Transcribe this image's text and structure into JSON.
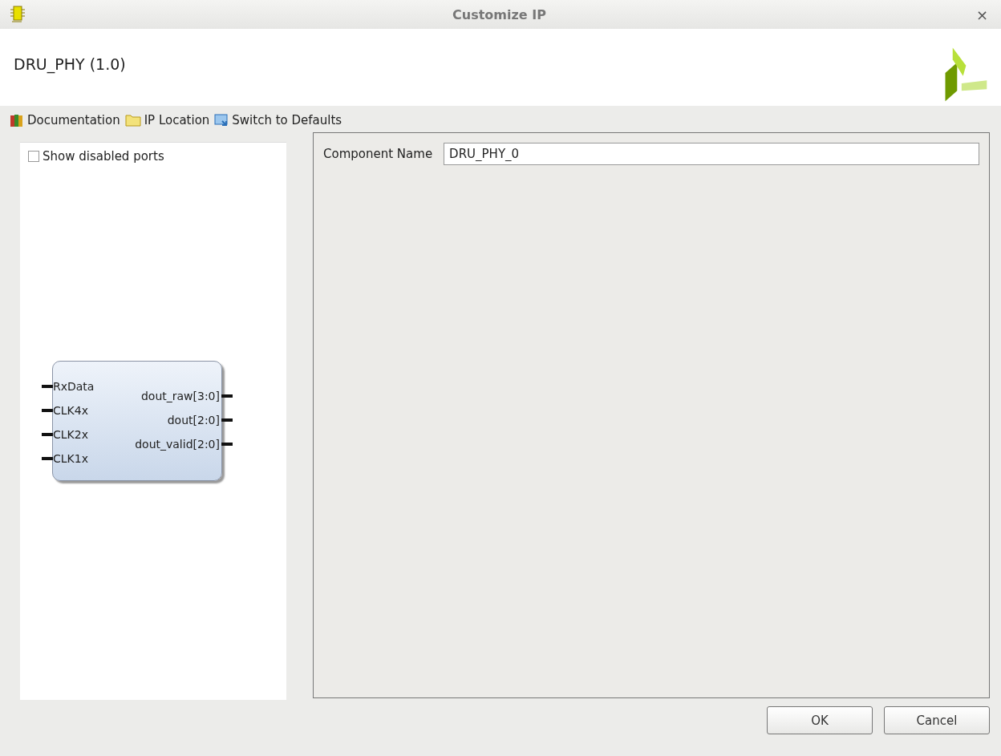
{
  "window": {
    "title": "Customize IP",
    "close": "×"
  },
  "header": {
    "title": "DRU_PHY (1.0)"
  },
  "toolbar": [
    {
      "kind": "book",
      "label": "Documentation"
    },
    {
      "kind": "folder",
      "label": "IP Location"
    },
    {
      "kind": "refresh",
      "label": "Switch to Defaults"
    }
  ],
  "symbol_panel": {
    "show_disabled_ports": {
      "label": "Show disabled ports",
      "checked": false
    },
    "block": {
      "inputs": [
        "RxData",
        "CLK4x",
        "CLK2x",
        "CLK1x"
      ],
      "outputs": [
        "dout_raw[3:0]",
        "dout[2:0]",
        "dout_valid[2:0]"
      ]
    }
  },
  "settings": {
    "component_name": {
      "label": "Component Name",
      "value": "DRU_PHY_0"
    }
  },
  "buttons": [
    "OK",
    "Cancel"
  ]
}
